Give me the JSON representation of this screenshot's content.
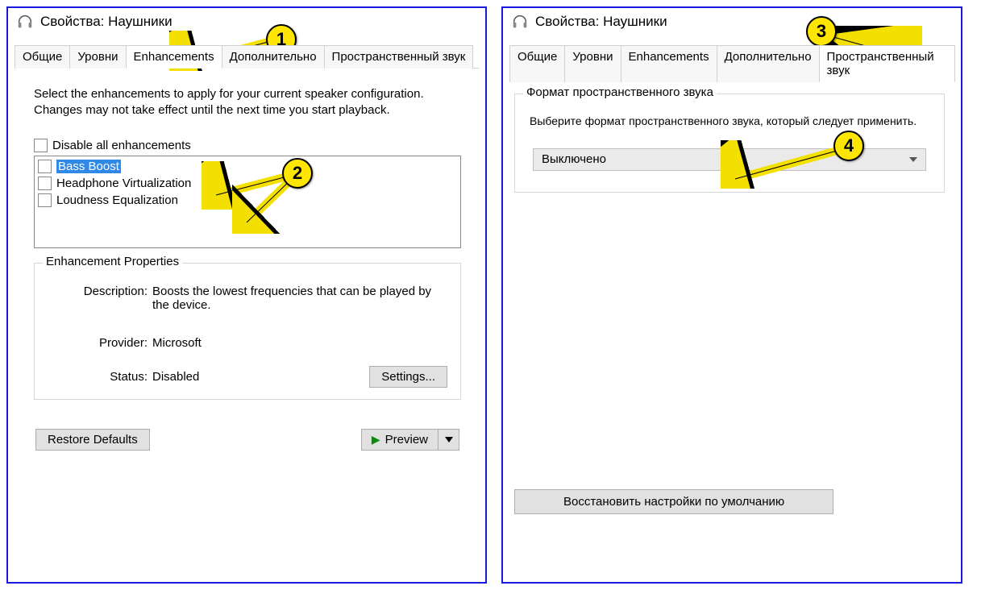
{
  "left": {
    "title": "Свойства: Наушники",
    "tabs": [
      "Общие",
      "Уровни",
      "Enhancements",
      "Дополнительно",
      "Пространственный звук"
    ],
    "active_tab": 2,
    "instruction": "Select the enhancements to apply for your current speaker configuration. Changes may not take effect until the next time you start playback.",
    "disable_all_label": "Disable all enhancements",
    "enhancements": [
      {
        "label": "Bass Boost",
        "selected": true
      },
      {
        "label": "Headphone Virtualization",
        "selected": false
      },
      {
        "label": "Loudness Equalization",
        "selected": false
      }
    ],
    "props_group_label": "Enhancement Properties",
    "desc_key": "Description:",
    "desc_val": "Boosts the lowest frequencies that can be played by the device.",
    "provider_key": "Provider:",
    "provider_val": "Microsoft",
    "status_key": "Status:",
    "status_val": "Disabled",
    "settings_btn": "Settings...",
    "restore_btn": "Restore Defaults",
    "preview_btn": "Preview"
  },
  "right": {
    "title": "Свойства: Наушники",
    "tabs": [
      "Общие",
      "Уровни",
      "Enhancements",
      "Дополнительно",
      "Пространственный звук"
    ],
    "active_tab": 4,
    "group_label": "Формат пространственного звука",
    "group_desc": "Выберите формат пространственного звука, который следует применить.",
    "dropdown_value": "Выключено",
    "restore_btn": "Восстановить настройки по умолчанию"
  },
  "annotations": {
    "a1": "1",
    "a2": "2",
    "a3": "3",
    "a4": "4"
  }
}
